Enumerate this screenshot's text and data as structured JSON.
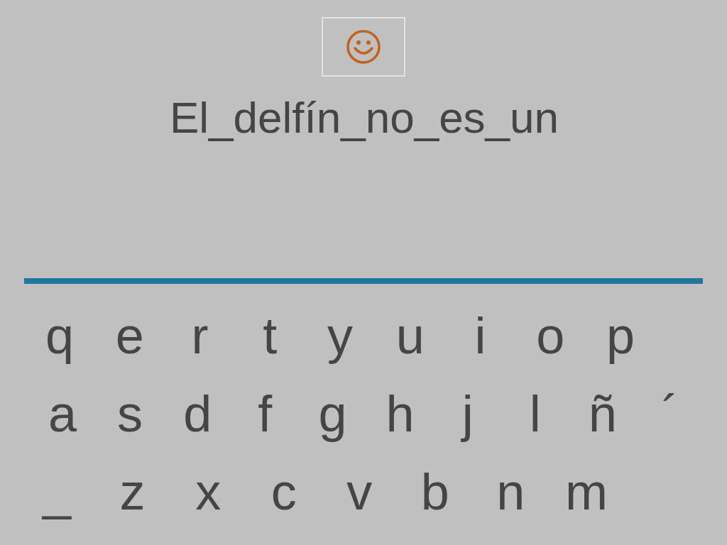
{
  "sentence": "El_delfín_no_es_un",
  "keyboard": {
    "rows": [
      [
        "q",
        "e",
        "r",
        "t",
        "y",
        "u",
        "i",
        "o",
        "p"
      ],
      [
        "a",
        "s",
        "d",
        "f",
        "g",
        "h",
        "j",
        "l",
        "ñ",
        "´"
      ],
      [
        "_",
        "z",
        "x",
        "c",
        "v",
        "b",
        "n",
        "m"
      ]
    ]
  }
}
